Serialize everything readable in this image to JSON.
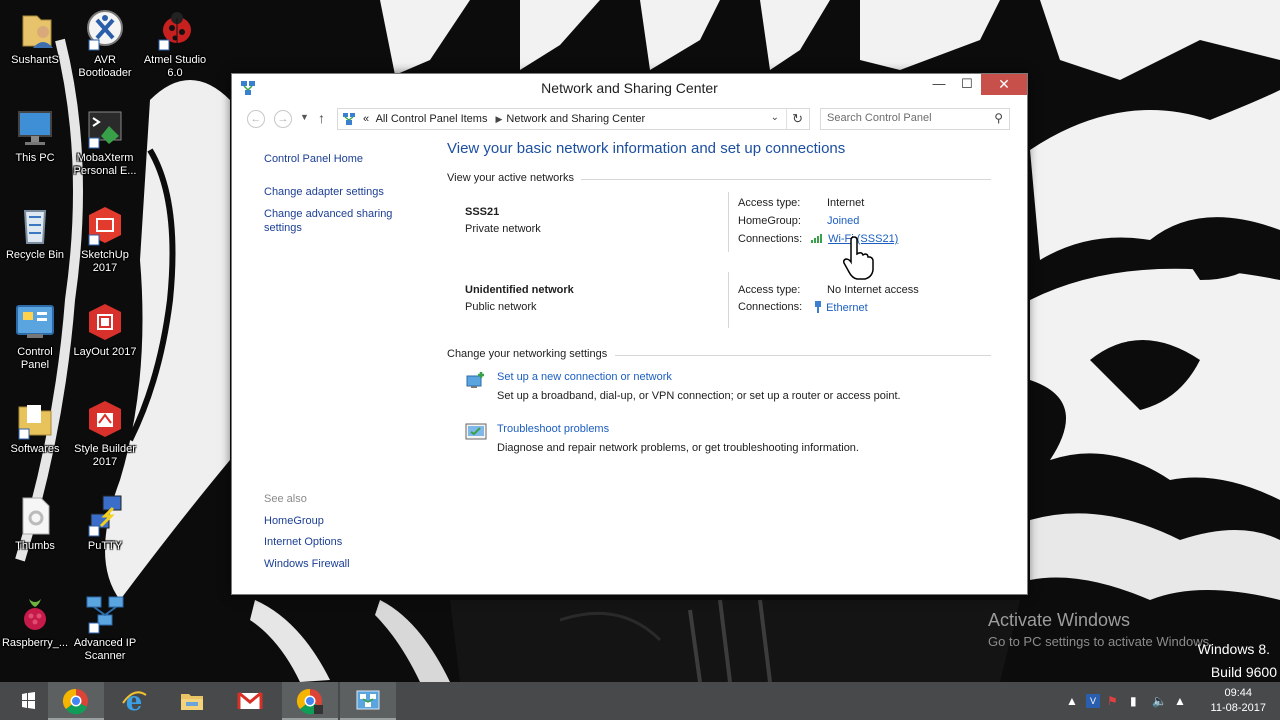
{
  "desktop": {
    "icons": [
      {
        "label": "SushantS",
        "icon": "user-folder-icon"
      },
      {
        "label": "AVR\nBootloader",
        "icon": "avr-bootloader-icon"
      },
      {
        "label": "Atmel Studio\n6.0",
        "icon": "atmel-studio-ladybug-icon"
      },
      {
        "label": "This PC",
        "icon": "computer-monitor-icon"
      },
      {
        "label": "MobaXterm\nPersonal E...",
        "icon": "mobaxterm-icon"
      },
      {
        "label": "Recycle Bin",
        "icon": "recycle-bin-icon"
      },
      {
        "label": "SketchUp\n2017",
        "icon": "sketchup-icon"
      },
      {
        "label": "Control\nPanel",
        "icon": "control-panel-icon"
      },
      {
        "label": "LayOut 2017",
        "icon": "layout-icon"
      },
      {
        "label": "Softwares",
        "icon": "folder-icon"
      },
      {
        "label": "Style Builder\n2017",
        "icon": "style-builder-icon"
      },
      {
        "label": "Thumbs",
        "icon": "thumbs-file-icon"
      },
      {
        "label": "PuTTY",
        "icon": "putty-icon"
      },
      {
        "label": "Raspberry_...",
        "icon": "raspberry-pi-icon"
      },
      {
        "label": "Advanced IP\nScanner",
        "icon": "advanced-ip-scanner-icon"
      }
    ]
  },
  "window": {
    "title": "Network and Sharing Center",
    "controls": {
      "minimize": "—",
      "maximize": "☐",
      "close": "✕"
    },
    "address": {
      "prefix": "«",
      "crumbs": [
        "All Control Panel Items",
        "Network and Sharing Center"
      ]
    },
    "search": {
      "placeholder": "Search Control Panel"
    },
    "left_pane": {
      "links": [
        "Control Panel Home",
        "Change adapter settings",
        "Change advanced sharing settings"
      ],
      "see_also_heading": "See also",
      "see_also": [
        "HomeGroup",
        "Internet Options",
        "Windows Firewall"
      ]
    },
    "main": {
      "title": "View your basic network information and set up connections",
      "active_networks_heading": "View your active networks",
      "networks": [
        {
          "name": "SSS21",
          "type": "Private network",
          "access_label": "Access type:",
          "access_value": "Internet",
          "homegroup_label": "HomeGroup:",
          "homegroup_value": "Joined",
          "connections_label": "Connections:",
          "connections_value": "Wi-Fi (SSS21)",
          "connections_icon": "wifi-signal-icon"
        },
        {
          "name": "Unidentified network",
          "type": "Public network",
          "access_label": "Access type:",
          "access_value": "No Internet access",
          "connections_label": "Connections:",
          "connections_value": "Ethernet",
          "connections_icon": "ethernet-icon"
        }
      ],
      "settings_heading": "Change your networking settings",
      "tasks": [
        {
          "link": "Set up a new connection or network",
          "desc": "Set up a broadband, dial-up, or VPN connection; or set up a router or access point.",
          "icon": "new-connection-icon"
        },
        {
          "link": "Troubleshoot problems",
          "desc": "Diagnose and repair network problems, or get troubleshooting information.",
          "icon": "troubleshoot-icon"
        }
      ]
    }
  },
  "watermark": {
    "title": "Activate Windows",
    "subtitle": "Go to PC settings to activate Windows.",
    "os": "Windows 8.",
    "build": "Build 9600"
  },
  "taskbar": {
    "items": [
      "start-button",
      "chrome-icon",
      "internet-explorer-icon",
      "file-explorer-icon",
      "gmail-icon",
      "chrome-user-icon",
      "network-center-icon"
    ],
    "clock": {
      "time": "09:44",
      "date": "11-08-2017"
    }
  },
  "colors": {
    "link": "#1c5fc0",
    "heading": "#1c4fa0",
    "close_button": "#c7504a",
    "taskbar": "#47494a"
  }
}
